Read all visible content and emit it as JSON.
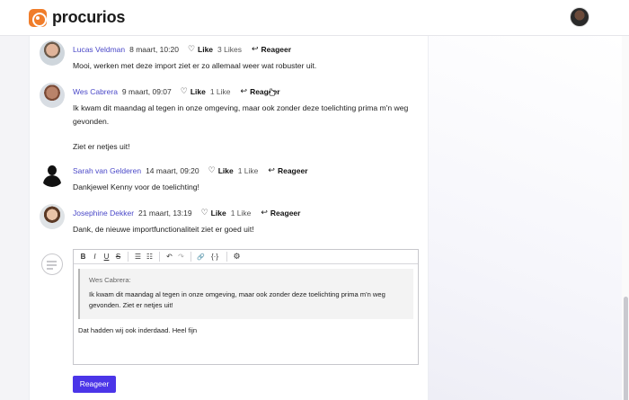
{
  "brand": {
    "name": "procurios",
    "color": "#f07d2a"
  },
  "accent_color": "#4b35e8",
  "comments": [
    {
      "author": "Lucas Veldman",
      "date": "8 maart, 10:20",
      "like_label": "Like",
      "likes": "3 Likes",
      "reply_label": "Reageer",
      "text": [
        "Mooi, werken met deze import ziet er zo allemaal weer wat robuster uit."
      ]
    },
    {
      "author": "Wes Cabrera",
      "date": "9 maart, 09:07",
      "like_label": "Like",
      "likes": "1 Like",
      "reply_label": "Reageer",
      "text": [
        "Ik kwam dit maandag al tegen in onze omgeving, maar ook zonder deze toelichting prima m'n weg gevonden.",
        "Ziet er netjes uit!"
      ]
    },
    {
      "author": "Sarah van Gelderen",
      "date": "14 maart, 09:20",
      "like_label": "Like",
      "likes": "1 Like",
      "reply_label": "Reageer",
      "text": [
        "Dankjewel Kenny voor de toelichting!"
      ]
    },
    {
      "author": "Josephine Dekker",
      "date": "21 maart, 13:19",
      "like_label": "Like",
      "likes": "1 Like",
      "reply_label": "Reageer",
      "text": [
        "Dank, de nieuwe importfunctionaliteit ziet er goed uit!"
      ]
    }
  ],
  "editor": {
    "toolbar": [
      {
        "name": "bold",
        "glyph": "B"
      },
      {
        "name": "italic",
        "glyph": "I"
      },
      {
        "name": "underline",
        "glyph": "U"
      },
      {
        "name": "strikethrough",
        "glyph": "S"
      },
      {
        "name": "bullet-list",
        "glyph": "☰"
      },
      {
        "name": "numbered-list",
        "glyph": "☷"
      },
      {
        "name": "undo",
        "glyph": "↶"
      },
      {
        "name": "redo",
        "glyph": "↷"
      },
      {
        "name": "link",
        "glyph": "🔗"
      },
      {
        "name": "code",
        "glyph": "{·}"
      },
      {
        "name": "settings",
        "glyph": "⚙"
      }
    ],
    "quote_author": "Wes Cabrera:",
    "quote_text": "Ik kwam dit maandag al tegen in onze omgeving, maar ook zonder deze toelichting prima m'n weg gevonden.  Ziet er netjes uit!",
    "reply_text": "Dat hadden wij ook inderdaad. Heel fijn"
  },
  "submit_label": "Reageer"
}
